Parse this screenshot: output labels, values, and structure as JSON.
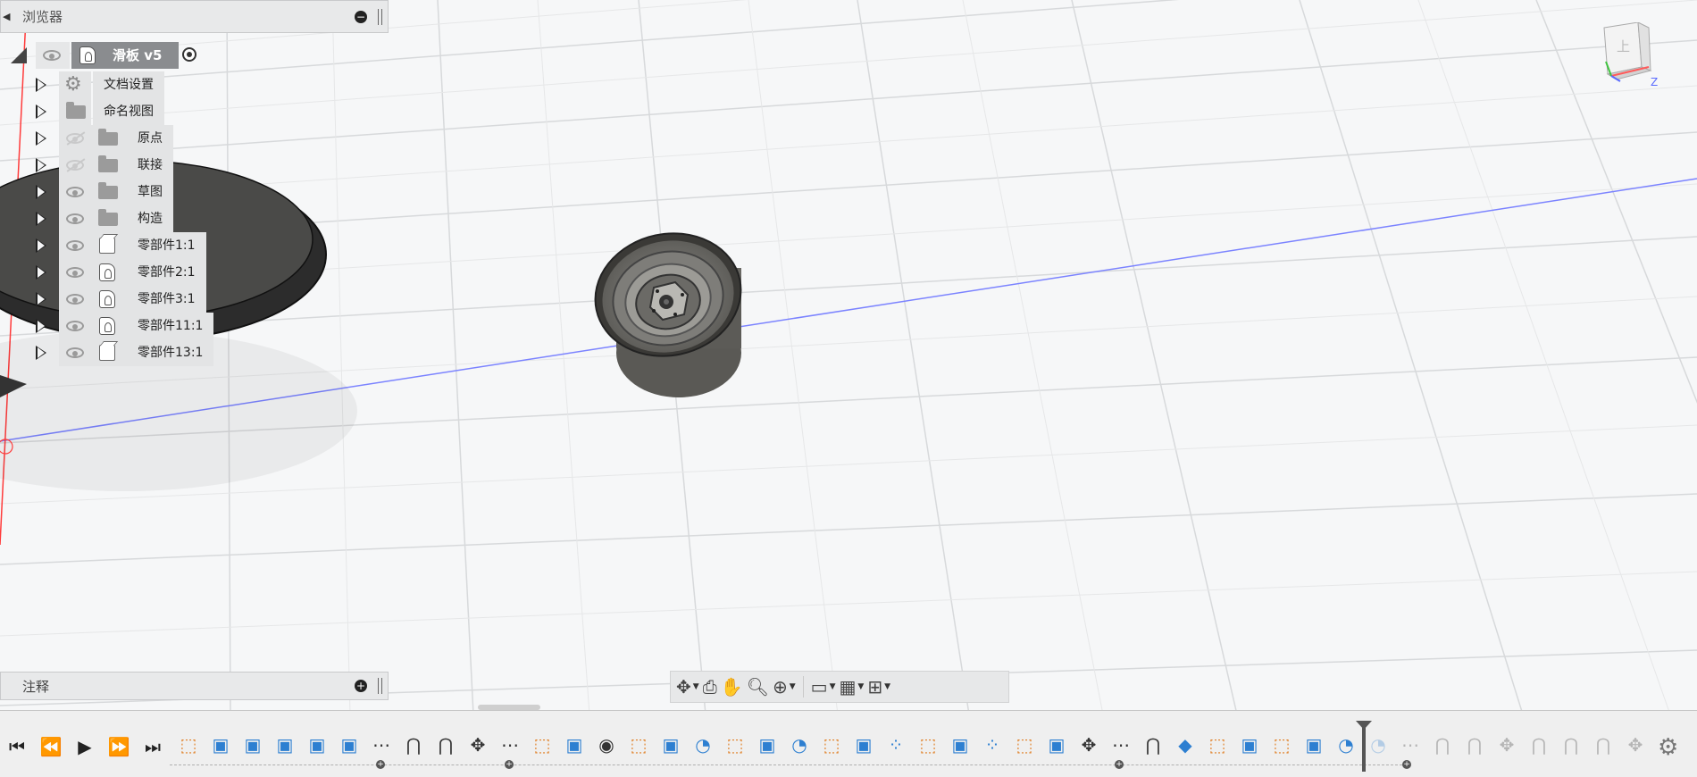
{
  "browser": {
    "title": "浏览器",
    "root_label": "滑板 v5",
    "items": [
      {
        "label": "文档设置",
        "icon": "gear-icon",
        "eye": "none"
      },
      {
        "label": "命名视图",
        "icon": "folder-icon",
        "eye": "none"
      },
      {
        "label": "原点",
        "icon": "folder-icon",
        "eye": "hidden"
      },
      {
        "label": "联接",
        "icon": "folder-icon",
        "eye": "hidden"
      },
      {
        "label": "草图",
        "icon": "folder-icon",
        "eye": "visible"
      },
      {
        "label": "构造",
        "icon": "folder-icon",
        "eye": "visible"
      },
      {
        "label": "零部件1:1",
        "icon": "body-icon",
        "eye": "visible"
      },
      {
        "label": "零部件2:1",
        "icon": "component-icon",
        "eye": "visible"
      },
      {
        "label": "零部件3:1",
        "icon": "component-icon",
        "eye": "visible"
      },
      {
        "label": "零部件11:1",
        "icon": "component-icon",
        "eye": "visible"
      },
      {
        "label": "零部件13:1",
        "icon": "body-icon",
        "eye": "visible"
      }
    ]
  },
  "annotations": {
    "title": "注释"
  },
  "viewcube": {
    "face_label": "上",
    "axis_label": "Z"
  },
  "nav_toolbar": {
    "buttons": [
      "orbit-icon",
      "look-at-icon",
      "pan-icon",
      "zoom-icon",
      "fit-icon",
      "display-settings-icon",
      "grid-icon",
      "viewports-icon"
    ]
  },
  "timeline": {
    "controls": [
      "go-to-start-icon",
      "step-back-icon",
      "play-icon",
      "step-forward-icon",
      "go-to-end-icon"
    ],
    "features": [
      "sketch",
      "extrude",
      "extrude",
      "extrude",
      "extrude",
      "extrude",
      "pattern",
      "joint",
      "joint",
      "move",
      "pattern",
      "sketch",
      "extrude",
      "point",
      "sketch",
      "extrude",
      "revolve",
      "sketch",
      "extrude",
      "revolve",
      "sketch",
      "extrude",
      "circular-pattern",
      "sketch",
      "extrude",
      "circular-pattern",
      "sketch",
      "extrude",
      "move",
      "pattern",
      "joint",
      "component",
      "sketch",
      "extrude",
      "sketch",
      "extrude",
      "revolve",
      "revolve",
      "pattern",
      "joint",
      "joint",
      "move",
      "joint",
      "joint",
      "joint",
      "move"
    ],
    "active_count": 37
  },
  "colors": {
    "accent_blue": "#2d7fd1",
    "sketch_orange": "#e07c1f",
    "axis_blue": "#7b83ff",
    "axis_red": "#ff3b3b"
  }
}
